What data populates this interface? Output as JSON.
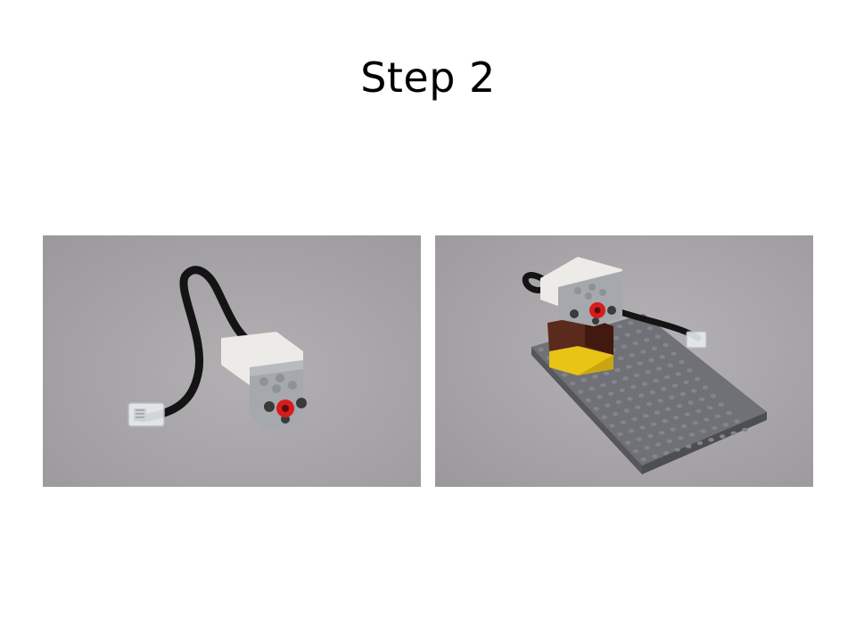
{
  "slide": {
    "title": "Step 2"
  },
  "photos": [
    {
      "subject": "motor-with-cable",
      "background_color": "#a8a5a9"
    },
    {
      "subject": "motor-mounted-on-baseplate",
      "background_color": "#a8a5a9"
    }
  ],
  "colors": {
    "motor_white": "#ecebe8",
    "motor_gray": "#a5a8ac",
    "axle_red": "#d61c1c",
    "cable_black": "#141414",
    "brick_yellow": "#e8c417",
    "brick_brown": "#5a2a1c",
    "baseplate_gray": "#6f7176"
  }
}
